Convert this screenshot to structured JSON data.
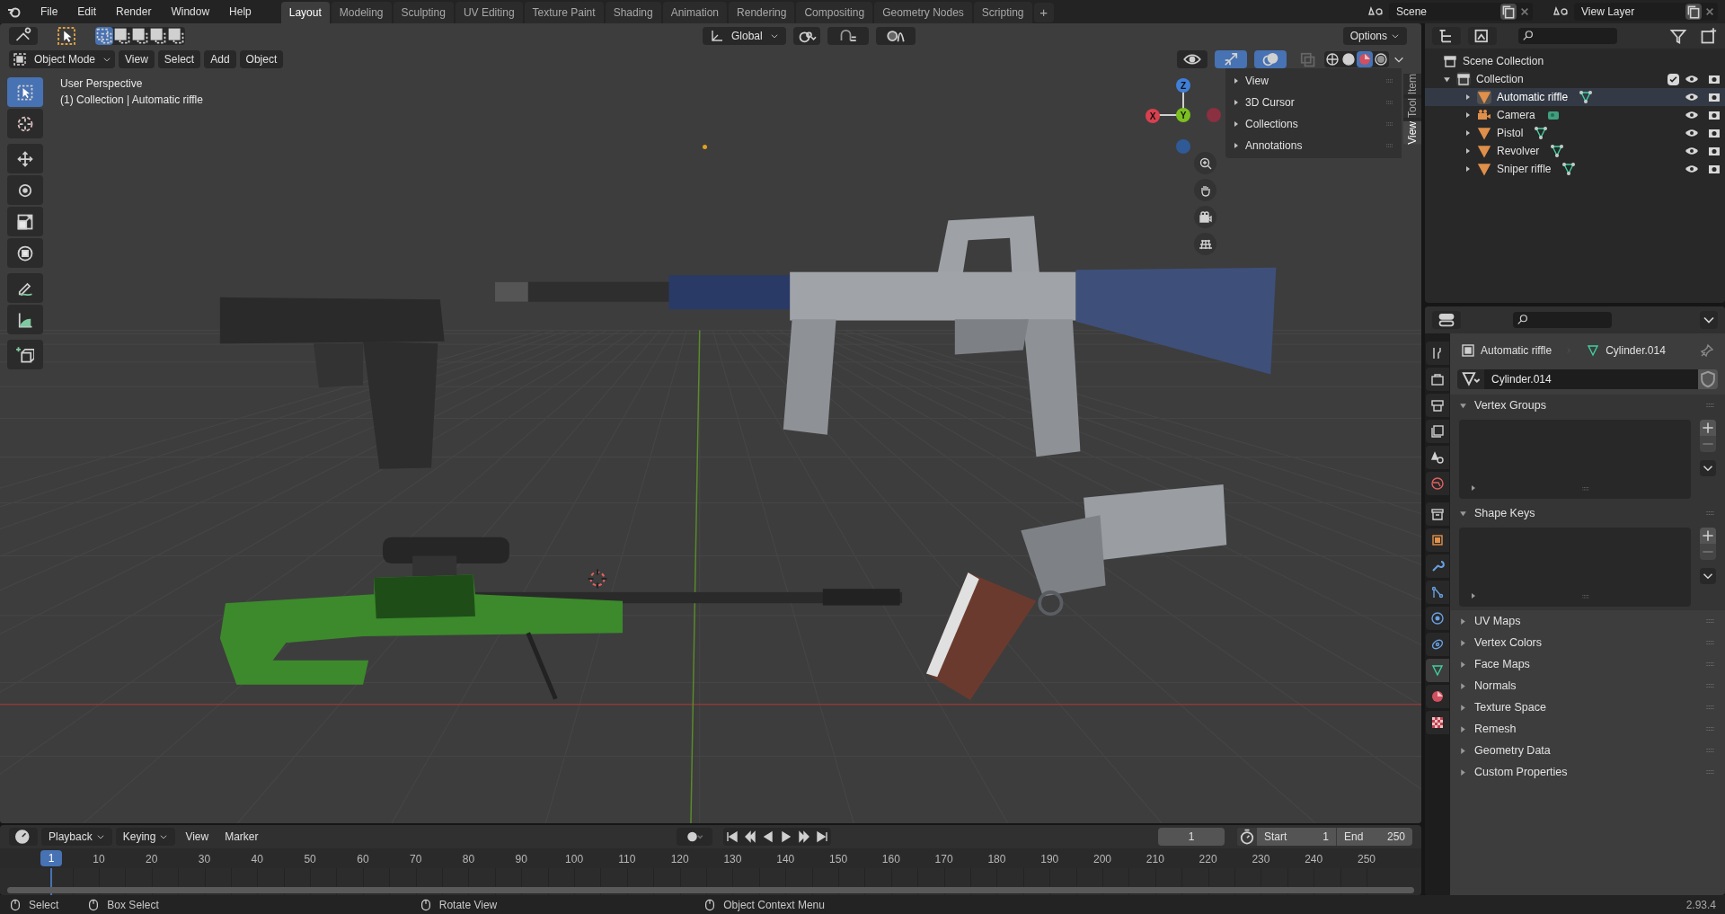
{
  "topbar": {
    "menus": [
      "File",
      "Edit",
      "Render",
      "Window",
      "Help"
    ],
    "workspaces": [
      {
        "label": "Layout",
        "selected": true
      },
      {
        "label": "Modeling",
        "selected": false
      },
      {
        "label": "Sculpting",
        "selected": false
      },
      {
        "label": "UV Editing",
        "selected": false
      },
      {
        "label": "Texture Paint",
        "selected": false
      },
      {
        "label": "Shading",
        "selected": false
      },
      {
        "label": "Animation",
        "selected": false
      },
      {
        "label": "Rendering",
        "selected": false
      },
      {
        "label": "Compositing",
        "selected": false
      },
      {
        "label": "Geometry Nodes",
        "selected": false
      },
      {
        "label": "Scripting",
        "selected": false
      }
    ],
    "add_tab": "+",
    "scene": "Scene",
    "view_layer": "View Layer"
  },
  "viewport": {
    "orientation": "Global",
    "mode": "Object Mode",
    "menus": [
      "View",
      "Select",
      "Add",
      "Object"
    ],
    "options": "Options",
    "overlay_lines": [
      "User Perspective",
      "(1) Collection | Automatic riffle"
    ],
    "shading": [
      {
        "kind": "wireframe",
        "selected": false
      },
      {
        "kind": "solid",
        "selected": false
      },
      {
        "kind": "material",
        "selected": true
      },
      {
        "kind": "rendered",
        "selected": false
      }
    ],
    "tool_groups": [
      [
        {
          "kind": "select",
          "selected": true
        },
        {
          "kind": "cursor",
          "selected": false
        }
      ],
      [
        {
          "kind": "move",
          "selected": false
        },
        {
          "kind": "rotate",
          "selected": false
        },
        {
          "kind": "scale",
          "selected": false
        },
        {
          "kind": "transform",
          "selected": false
        }
      ],
      [
        {
          "kind": "annotate",
          "selected": false
        },
        {
          "kind": "measure",
          "selected": false
        }
      ],
      [
        {
          "kind": "add-cube",
          "selected": false
        }
      ]
    ],
    "gizmo": {
      "z": "Z",
      "y": "Y",
      "x": "X"
    },
    "sidebar": {
      "panels": [
        "View",
        "3D Cursor",
        "Collections",
        "Annotations"
      ],
      "tabs": [
        {
          "label": "Item",
          "selected": false
        },
        {
          "label": "Tool",
          "selected": false
        },
        {
          "label": "View",
          "selected": true
        }
      ]
    }
  },
  "outliner": {
    "root": "Scene Collection",
    "collection": {
      "label": "Collection",
      "expanded": true,
      "checked": true,
      "children": [
        {
          "label": "Automatic riffle",
          "kind": "mesh",
          "selected": true
        },
        {
          "label": "Camera",
          "kind": "camera",
          "selected": false
        },
        {
          "label": "Pistol",
          "kind": "mesh",
          "selected": false
        },
        {
          "label": "Revolver",
          "kind": "mesh",
          "selected": false
        },
        {
          "label": "Sniper riffle",
          "kind": "mesh",
          "selected": false
        }
      ]
    }
  },
  "properties": {
    "object": "Automatic riffle",
    "data": "Cylinder.014",
    "data_field": "Cylinder.014",
    "tabs": [
      {
        "kind": "tool",
        "selected": false
      },
      {
        "kind": "render",
        "selected": false
      },
      {
        "kind": "output",
        "selected": false
      },
      {
        "kind": "view-layer",
        "selected": false
      },
      {
        "kind": "scene",
        "selected": false
      },
      {
        "kind": "world",
        "selected": false
      },
      {
        "kind": "collection",
        "selected": false
      },
      {
        "kind": "object",
        "selected": false
      },
      {
        "kind": "modifiers",
        "selected": false
      },
      {
        "kind": "particles",
        "selected": false
      },
      {
        "kind": "physics",
        "selected": false
      },
      {
        "kind": "constraints",
        "selected": false
      },
      {
        "kind": "data",
        "selected": true
      },
      {
        "kind": "material",
        "selected": false
      },
      {
        "kind": "texture",
        "selected": false
      }
    ],
    "panels": [
      {
        "label": "Vertex Groups",
        "expanded": true
      },
      {
        "label": "Shape Keys",
        "expanded": true
      },
      {
        "label": "UV Maps",
        "expanded": false
      },
      {
        "label": "Vertex Colors",
        "expanded": false
      },
      {
        "label": "Face Maps",
        "expanded": false
      },
      {
        "label": "Normals",
        "expanded": false
      },
      {
        "label": "Texture Space",
        "expanded": false
      },
      {
        "label": "Remesh",
        "expanded": false
      },
      {
        "label": "Geometry Data",
        "expanded": false
      },
      {
        "label": "Custom Properties",
        "expanded": false
      }
    ]
  },
  "timeline": {
    "menus": [
      "Playback",
      "Keying",
      "View",
      "Marker"
    ],
    "current_frame": "1",
    "start_label": "Start",
    "start": "1",
    "end_label": "End",
    "end": "250",
    "playhead": "1",
    "ruler": [
      "10",
      "20",
      "30",
      "40",
      "50",
      "60",
      "70",
      "80",
      "90",
      "100",
      "110",
      "120",
      "130",
      "140",
      "150",
      "160",
      "170",
      "180",
      "190",
      "200",
      "210",
      "220",
      "230",
      "240",
      "250"
    ]
  },
  "status_bar": {
    "hints": [
      "Select",
      "Box Select",
      "Rotate View",
      "Object Context Menu"
    ],
    "version": "2.93.4"
  }
}
